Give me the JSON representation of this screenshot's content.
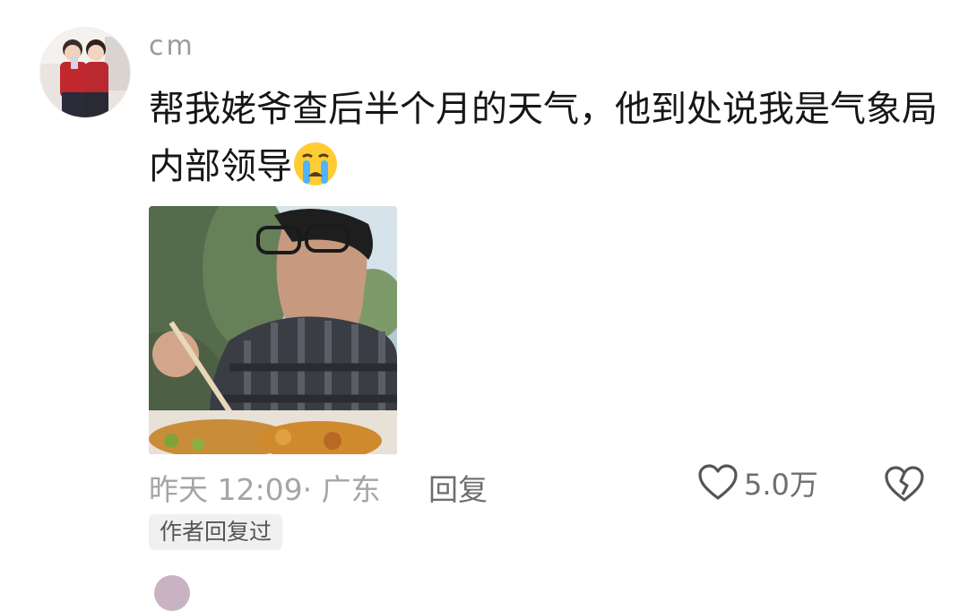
{
  "comment": {
    "username": "cm",
    "text": "帮我姥爷查后半个月的天气，他到处说我是气象局内部领导",
    "emoji": "loudly-crying-face",
    "timestamp_location": "昨天 12:09· 广东",
    "reply_label": "回复",
    "like_count": "5.0万",
    "author_replied_badge": "作者回复过"
  },
  "icons": {
    "like": "heart-outline-icon",
    "dislike": "broken-heart-icon"
  },
  "colors": {
    "text_primary": "#161616",
    "text_secondary": "#a5a5a5",
    "text_action": "#6e6e6e",
    "badge_bg": "#f0f0f0"
  }
}
